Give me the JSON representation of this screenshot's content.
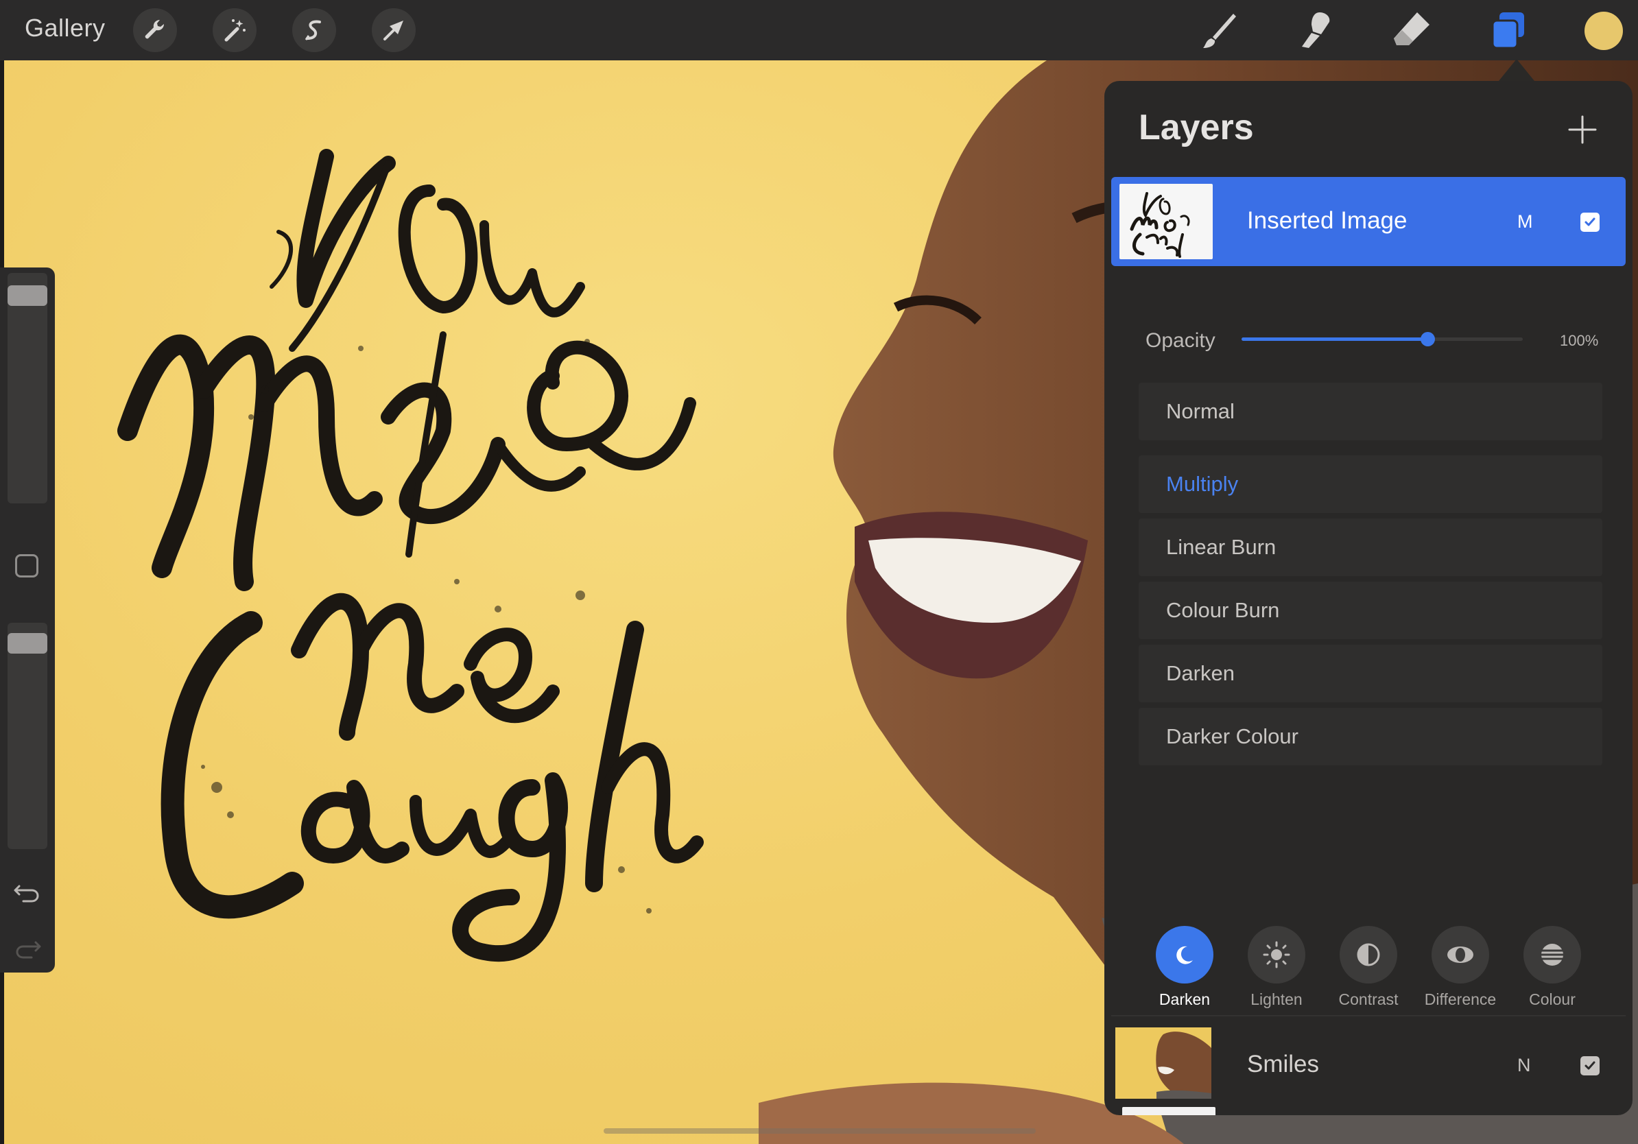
{
  "toolbar": {
    "gallery_label": "Gallery",
    "left_tools": [
      "wrench-icon",
      "magic-wand-icon",
      "selection-icon",
      "transform-arrow-icon"
    ],
    "right_tools": [
      "brush-icon",
      "smudge-icon",
      "eraser-icon",
      "layers-icon"
    ],
    "active_tool": "layers-icon",
    "current_color": "#e7c76c"
  },
  "sidebar": {
    "brush_size_level": 0.06,
    "brush_opacity_level": 0.05,
    "icons": [
      "modify-square-icon",
      "undo-icon",
      "redo-icon"
    ]
  },
  "layers_panel": {
    "title": "Layers",
    "add_icon": "plus-icon",
    "active_layer": {
      "name": "Inserted Image",
      "blend_code": "M",
      "visible": true
    },
    "opacity": {
      "label": "Opacity",
      "value": 100,
      "value_text": "100%"
    },
    "blend_modes": [
      {
        "label": "Normal",
        "selected": false
      },
      {
        "label": "Multiply",
        "selected": true
      },
      {
        "label": "Linear Burn",
        "selected": false
      },
      {
        "label": "Colour Burn",
        "selected": false
      },
      {
        "label": "Darken",
        "selected": false
      },
      {
        "label": "Darker Colour",
        "selected": false
      }
    ],
    "categories": [
      {
        "label": "Darken",
        "icon": "moon-icon",
        "active": true
      },
      {
        "label": "Lighten",
        "icon": "sun-icon",
        "active": false
      },
      {
        "label": "Contrast",
        "icon": "contrast-icon",
        "active": false
      },
      {
        "label": "Difference",
        "icon": "difference-icon",
        "active": false
      },
      {
        "label": "Colour",
        "icon": "colour-icon",
        "active": false
      }
    ],
    "other_layer": {
      "name": "Smiles",
      "blend_code": "N",
      "visible": true
    },
    "accent_color": "#3b77ea"
  }
}
